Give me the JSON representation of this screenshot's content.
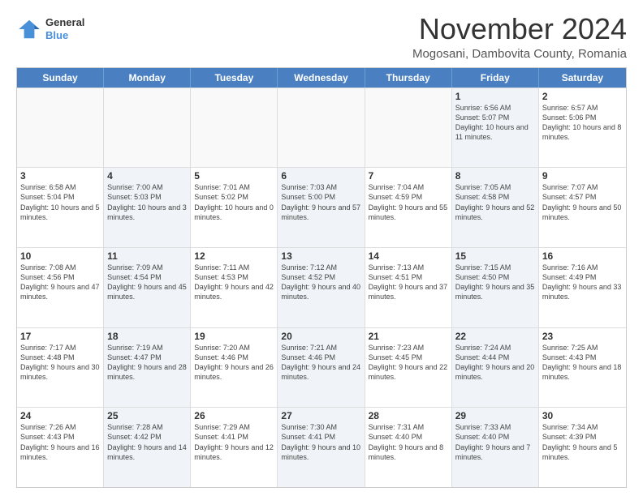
{
  "logo": {
    "line1": "General",
    "line2": "Blue"
  },
  "title": "November 2024",
  "location": "Mogosani, Dambovita County, Romania",
  "header_days": [
    "Sunday",
    "Monday",
    "Tuesday",
    "Wednesday",
    "Thursday",
    "Friday",
    "Saturday"
  ],
  "rows": [
    [
      {
        "day": "",
        "text": "",
        "shaded": false,
        "empty": true
      },
      {
        "day": "",
        "text": "",
        "shaded": false,
        "empty": true
      },
      {
        "day": "",
        "text": "",
        "shaded": false,
        "empty": true
      },
      {
        "day": "",
        "text": "",
        "shaded": false,
        "empty": true
      },
      {
        "day": "",
        "text": "",
        "shaded": false,
        "empty": true
      },
      {
        "day": "1",
        "text": "Sunrise: 6:56 AM\nSunset: 5:07 PM\nDaylight: 10 hours and 11 minutes.",
        "shaded": true,
        "empty": false
      },
      {
        "day": "2",
        "text": "Sunrise: 6:57 AM\nSunset: 5:06 PM\nDaylight: 10 hours and 8 minutes.",
        "shaded": false,
        "empty": false
      }
    ],
    [
      {
        "day": "3",
        "text": "Sunrise: 6:58 AM\nSunset: 5:04 PM\nDaylight: 10 hours and 5 minutes.",
        "shaded": false,
        "empty": false
      },
      {
        "day": "4",
        "text": "Sunrise: 7:00 AM\nSunset: 5:03 PM\nDaylight: 10 hours and 3 minutes.",
        "shaded": true,
        "empty": false
      },
      {
        "day": "5",
        "text": "Sunrise: 7:01 AM\nSunset: 5:02 PM\nDaylight: 10 hours and 0 minutes.",
        "shaded": false,
        "empty": false
      },
      {
        "day": "6",
        "text": "Sunrise: 7:03 AM\nSunset: 5:00 PM\nDaylight: 9 hours and 57 minutes.",
        "shaded": true,
        "empty": false
      },
      {
        "day": "7",
        "text": "Sunrise: 7:04 AM\nSunset: 4:59 PM\nDaylight: 9 hours and 55 minutes.",
        "shaded": false,
        "empty": false
      },
      {
        "day": "8",
        "text": "Sunrise: 7:05 AM\nSunset: 4:58 PM\nDaylight: 9 hours and 52 minutes.",
        "shaded": true,
        "empty": false
      },
      {
        "day": "9",
        "text": "Sunrise: 7:07 AM\nSunset: 4:57 PM\nDaylight: 9 hours and 50 minutes.",
        "shaded": false,
        "empty": false
      }
    ],
    [
      {
        "day": "10",
        "text": "Sunrise: 7:08 AM\nSunset: 4:56 PM\nDaylight: 9 hours and 47 minutes.",
        "shaded": false,
        "empty": false
      },
      {
        "day": "11",
        "text": "Sunrise: 7:09 AM\nSunset: 4:54 PM\nDaylight: 9 hours and 45 minutes.",
        "shaded": true,
        "empty": false
      },
      {
        "day": "12",
        "text": "Sunrise: 7:11 AM\nSunset: 4:53 PM\nDaylight: 9 hours and 42 minutes.",
        "shaded": false,
        "empty": false
      },
      {
        "day": "13",
        "text": "Sunrise: 7:12 AM\nSunset: 4:52 PM\nDaylight: 9 hours and 40 minutes.",
        "shaded": true,
        "empty": false
      },
      {
        "day": "14",
        "text": "Sunrise: 7:13 AM\nSunset: 4:51 PM\nDaylight: 9 hours and 37 minutes.",
        "shaded": false,
        "empty": false
      },
      {
        "day": "15",
        "text": "Sunrise: 7:15 AM\nSunset: 4:50 PM\nDaylight: 9 hours and 35 minutes.",
        "shaded": true,
        "empty": false
      },
      {
        "day": "16",
        "text": "Sunrise: 7:16 AM\nSunset: 4:49 PM\nDaylight: 9 hours and 33 minutes.",
        "shaded": false,
        "empty": false
      }
    ],
    [
      {
        "day": "17",
        "text": "Sunrise: 7:17 AM\nSunset: 4:48 PM\nDaylight: 9 hours and 30 minutes.",
        "shaded": false,
        "empty": false
      },
      {
        "day": "18",
        "text": "Sunrise: 7:19 AM\nSunset: 4:47 PM\nDaylight: 9 hours and 28 minutes.",
        "shaded": true,
        "empty": false
      },
      {
        "day": "19",
        "text": "Sunrise: 7:20 AM\nSunset: 4:46 PM\nDaylight: 9 hours and 26 minutes.",
        "shaded": false,
        "empty": false
      },
      {
        "day": "20",
        "text": "Sunrise: 7:21 AM\nSunset: 4:46 PM\nDaylight: 9 hours and 24 minutes.",
        "shaded": true,
        "empty": false
      },
      {
        "day": "21",
        "text": "Sunrise: 7:23 AM\nSunset: 4:45 PM\nDaylight: 9 hours and 22 minutes.",
        "shaded": false,
        "empty": false
      },
      {
        "day": "22",
        "text": "Sunrise: 7:24 AM\nSunset: 4:44 PM\nDaylight: 9 hours and 20 minutes.",
        "shaded": true,
        "empty": false
      },
      {
        "day": "23",
        "text": "Sunrise: 7:25 AM\nSunset: 4:43 PM\nDaylight: 9 hours and 18 minutes.",
        "shaded": false,
        "empty": false
      }
    ],
    [
      {
        "day": "24",
        "text": "Sunrise: 7:26 AM\nSunset: 4:43 PM\nDaylight: 9 hours and 16 minutes.",
        "shaded": false,
        "empty": false
      },
      {
        "day": "25",
        "text": "Sunrise: 7:28 AM\nSunset: 4:42 PM\nDaylight: 9 hours and 14 minutes.",
        "shaded": true,
        "empty": false
      },
      {
        "day": "26",
        "text": "Sunrise: 7:29 AM\nSunset: 4:41 PM\nDaylight: 9 hours and 12 minutes.",
        "shaded": false,
        "empty": false
      },
      {
        "day": "27",
        "text": "Sunrise: 7:30 AM\nSunset: 4:41 PM\nDaylight: 9 hours and 10 minutes.",
        "shaded": true,
        "empty": false
      },
      {
        "day": "28",
        "text": "Sunrise: 7:31 AM\nSunset: 4:40 PM\nDaylight: 9 hours and 8 minutes.",
        "shaded": false,
        "empty": false
      },
      {
        "day": "29",
        "text": "Sunrise: 7:33 AM\nSunset: 4:40 PM\nDaylight: 9 hours and 7 minutes.",
        "shaded": true,
        "empty": false
      },
      {
        "day": "30",
        "text": "Sunrise: 7:34 AM\nSunset: 4:39 PM\nDaylight: 9 hours and 5 minutes.",
        "shaded": false,
        "empty": false
      }
    ]
  ]
}
